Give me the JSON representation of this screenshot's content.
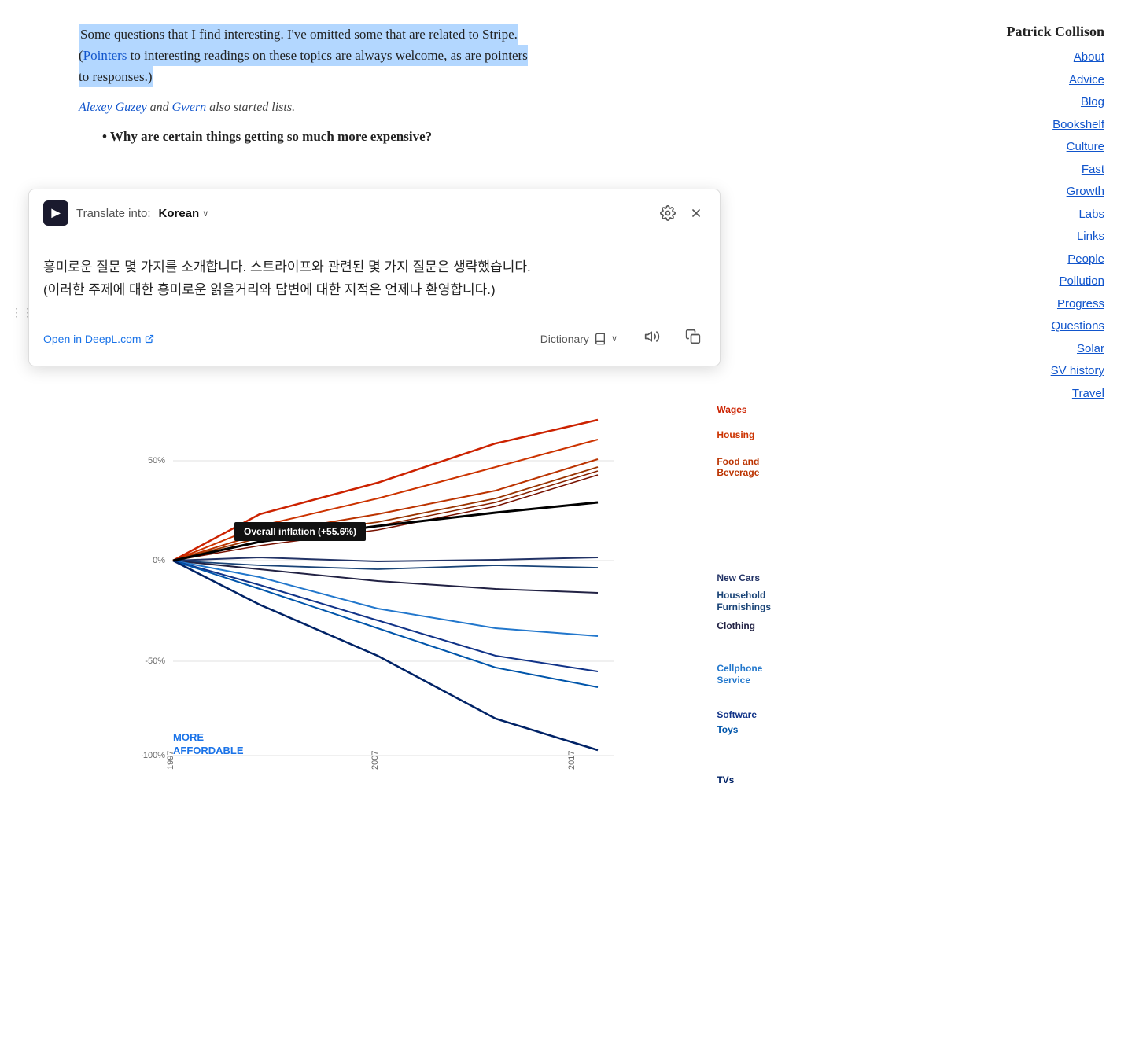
{
  "site": {
    "author": "Patrick Collison"
  },
  "nav": {
    "items": [
      {
        "label": "About",
        "url": "#"
      },
      {
        "label": "Advice",
        "url": "#"
      },
      {
        "label": "Blog",
        "url": "#"
      },
      {
        "label": "Bookshelf",
        "url": "#"
      },
      {
        "label": "Culture",
        "url": "#"
      },
      {
        "label": "Fast",
        "url": "#"
      },
      {
        "label": "Growth",
        "url": "#"
      },
      {
        "label": "Labs",
        "url": "#"
      },
      {
        "label": "Links",
        "url": "#"
      },
      {
        "label": "People",
        "url": "#"
      },
      {
        "label": "Pollution",
        "url": "#"
      },
      {
        "label": "Progress",
        "url": "#"
      },
      {
        "label": "Questions",
        "url": "#"
      },
      {
        "label": "Solar",
        "url": "#"
      },
      {
        "label": "SV history",
        "url": "#"
      },
      {
        "label": "Travel",
        "url": "#"
      }
    ]
  },
  "main": {
    "highlight_text_1": "Some questions that I find interesting. I've omitted some that are related to Stripe.",
    "highlight_text_2": "(",
    "highlight_link": "Pointers",
    "highlight_text_3": " to interesting readings on these topics are always welcome, as are pointers to responses.)",
    "author_line_1": "Alexey Guzey",
    "author_line_2": " and ",
    "author_link": "Gwern",
    "author_line_3": " also started lists.",
    "bullet": "Why are certain things getting so much more expensive?"
  },
  "translate_popup": {
    "translate_into_label": "Translate into:",
    "language": "Korean",
    "translated_text": "흥미로운 질문 몇 가지를 소개합니다. 스트라이프와 관련된 몇 가지 질문은 생략했습니다.\n(이러한 주제에 대한 흥미로운 읽을거리와 답변에 대한 지적은 언제나 환영합니다.)",
    "open_deepl": "Open in DeepL.com",
    "dictionary": "Dictionary",
    "external_icon": "↗",
    "book_icon": "📖",
    "chevron": "∨",
    "gear_icon": "⚙",
    "close_icon": "✕",
    "sound_icon": "🔊",
    "copy_icon": "⧉"
  },
  "chart": {
    "tooltip": "Overall inflation (+55.6%)",
    "more_affordable": "MORE\nAFFORDABLE",
    "labels": {
      "wages": "Wages",
      "housing": "Housing",
      "food_beverage": "Food and\nBeverage",
      "new_cars": "New Cars",
      "household": "Household\nFurnishings",
      "clothing": "Clothing",
      "cellphone": "Cellphone\nService",
      "software": "Software",
      "toys": "Toys",
      "tvs": "TVs"
    },
    "y_labels": [
      "50%",
      "0%",
      "-50%",
      "-100%"
    ],
    "x_labels": [
      "1997",
      "2007",
      "2017"
    ]
  },
  "drag_handle": "⋮⋮"
}
